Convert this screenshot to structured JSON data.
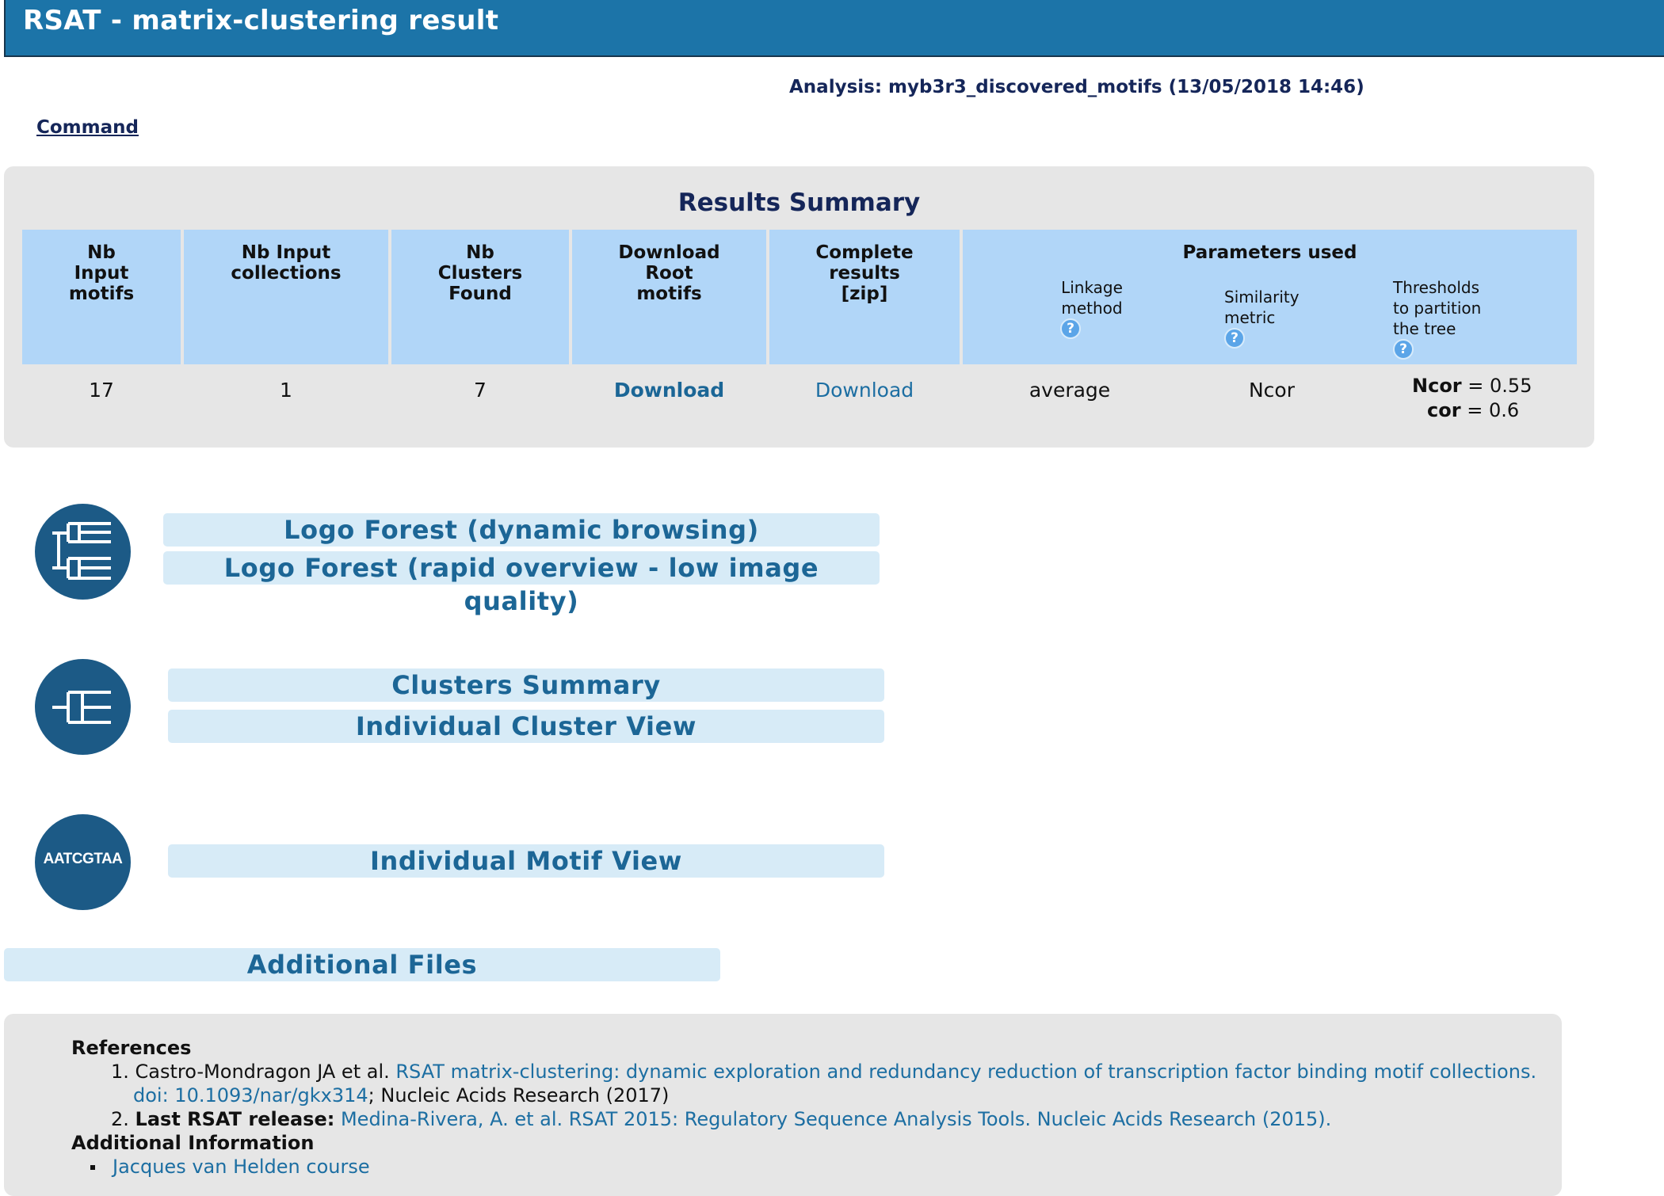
{
  "header": {
    "title": "RSAT - matrix-clustering result"
  },
  "analysis": "Analysis: myb3r3_discovered_motifs (13/05/2018 14:46)",
  "command_link": "Command",
  "summary": {
    "title": "Results Summary",
    "headers": {
      "nb_input_motifs": [
        "Nb",
        "Input",
        "motifs"
      ],
      "nb_input_collections": [
        "Nb Input",
        "collections"
      ],
      "nb_clusters_found": [
        "Nb",
        "Clusters",
        "Found"
      ],
      "download_root_motifs": [
        "Download",
        "Root",
        "motifs"
      ],
      "complete_results": [
        "Complete",
        "results",
        "[zip]"
      ],
      "parameters_used": "Parameters used",
      "linkage_method": [
        "Linkage",
        "method"
      ],
      "similarity_metric": [
        "Similarity",
        "metric"
      ],
      "thresholds": [
        "Thresholds",
        "to partition",
        "the tree"
      ]
    },
    "help_glyph": "?",
    "values": {
      "nb_input_motifs": "17",
      "nb_input_collections": "1",
      "nb_clusters_found": "7",
      "download_root_motifs": "Download",
      "complete_results": "Download",
      "linkage_method": "average",
      "similarity_metric": "Ncor",
      "threshold_ncor_label": "Ncor",
      "threshold_ncor_value": "= 0.55",
      "threshold_cor_label": "cor",
      "threshold_cor_value": "= 0.6"
    }
  },
  "nav": {
    "logo_forest_dynamic": "Logo Forest (dynamic browsing)",
    "logo_forest_rapid": "Logo Forest (rapid overview - low image quality)",
    "clusters_summary": "Clusters Summary",
    "individual_cluster_view": "Individual Cluster View",
    "individual_motif_view": "Individual Motif View",
    "motif_icon_text": "AATCGTAA",
    "additional_files": "Additional Files"
  },
  "references": {
    "heading": "References",
    "ref1_number": "1.",
    "ref1_authors": "Castro-Mondragon JA et al.",
    "ref1_title": "RSAT matrix-clustering: dynamic exploration and redundancy reduction of transcription factor binding motif collections.",
    "ref1_doi": "doi: 10.1093/nar/gkx314",
    "ref1_journal": "; Nucleic Acids Research (2017)",
    "ref2_number": "2.",
    "ref2_label": "Last RSAT release:",
    "ref2_link": "Medina-Rivera, A. et al. RSAT 2015: Regulatory Sequence Analysis Tools. Nucleic Acids Research (2015).",
    "additional_heading": "Additional Information",
    "additional_item": "Jacques van Helden course"
  },
  "colors": {
    "header_bg": "#1c74a8",
    "table_header_bg": "#b1d6f8",
    "nav_button_bg": "#d7ebf7",
    "icon_circle": "#1c5a86",
    "link": "#1c6ea2"
  }
}
